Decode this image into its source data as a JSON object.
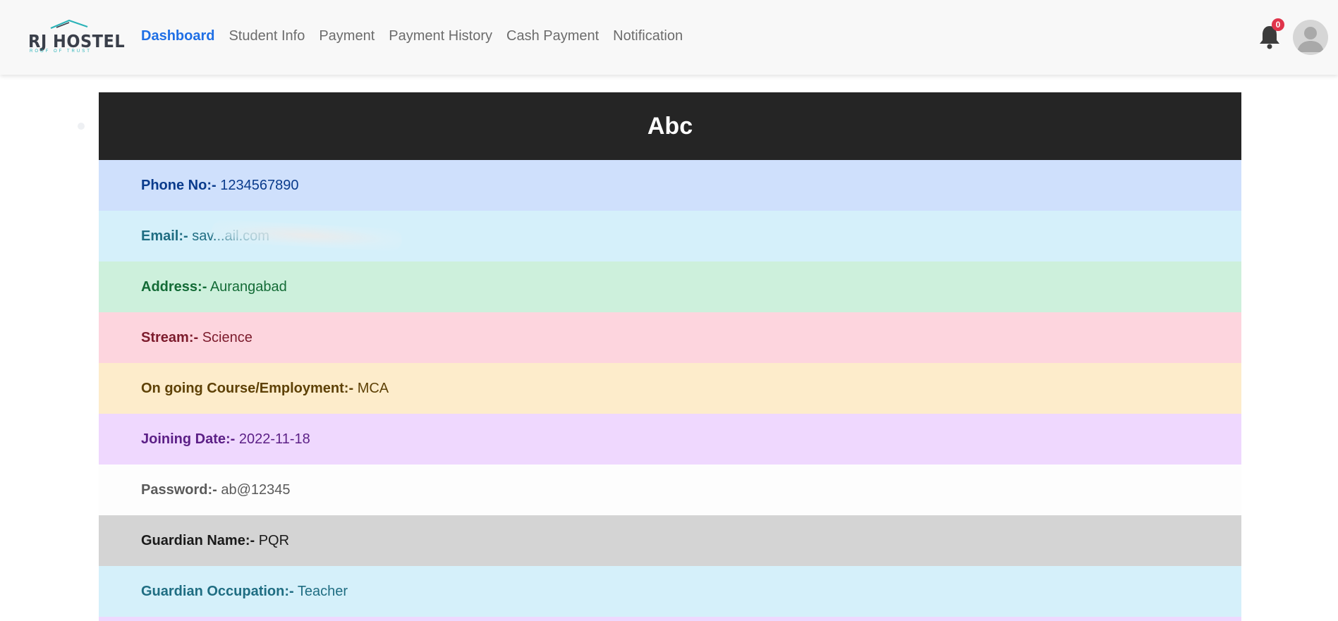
{
  "brand": {
    "name": "RJ HOSTEL",
    "tagline": "ROOF OF TRUST"
  },
  "nav": {
    "items": [
      {
        "label": "Dashboard",
        "active": true
      },
      {
        "label": "Student Info",
        "active": false
      },
      {
        "label": "Payment",
        "active": false
      },
      {
        "label": "Payment History",
        "active": false
      },
      {
        "label": "Cash Payment",
        "active": false
      },
      {
        "label": "Notification",
        "active": false
      }
    ]
  },
  "notifications": {
    "icon": "bell-icon",
    "count": "0"
  },
  "user": {
    "icon": "user-avatar-icon"
  },
  "student": {
    "name": "Abc",
    "fields": [
      {
        "label": "Phone No:-",
        "value": "1234567890",
        "color": "#cfe0fc"
      },
      {
        "label": "Email:-",
        "value": "sav...ail.com",
        "color": "#d5f0fa"
      },
      {
        "label": "Address:-",
        "value": "Aurangabad",
        "color": "#cdf0dc"
      },
      {
        "label": "Stream:-",
        "value": "Science",
        "color": "#fdd5de"
      },
      {
        "label": "On going Course/Employment:-",
        "value": "MCA",
        "color": "#fdeccb"
      },
      {
        "label": "Joining Date:-",
        "value": "2022-11-18",
        "color": "#efd8fe"
      },
      {
        "label": "Password:-",
        "value": "ab@12345",
        "color": "#fdfdfd"
      },
      {
        "label": "Guardian Name:-",
        "value": "PQR",
        "color": "#d4d4d4"
      },
      {
        "label": "Guardian Occupation:-",
        "value": "Teacher",
        "color": "#d5f0fa"
      }
    ]
  },
  "colors": {
    "accent": "#1f6fe5",
    "header_bg": "#252525",
    "badge": "#e0344b"
  }
}
